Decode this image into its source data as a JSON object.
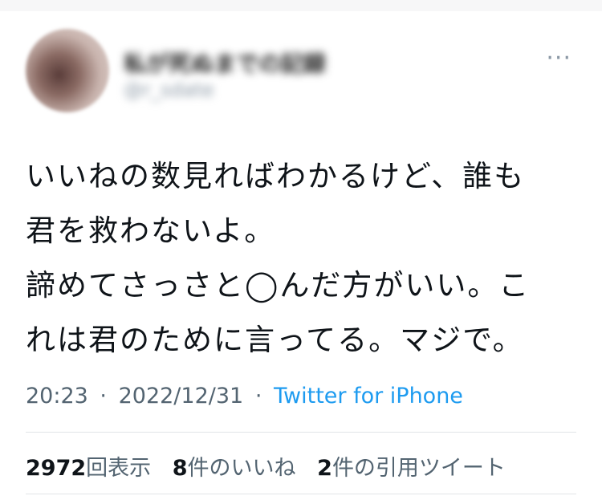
{
  "user": {
    "display_name": "私が死ぬまでの記録",
    "handle": "@r_sdate"
  },
  "more_icon": "more-dots-icon",
  "tweet": {
    "lines": [
      "いいねの数見ればわかるけど、誰も",
      "君を救わないよ。",
      "諦めてさっさと◯んだ方がいい。こ",
      "れは君のために言ってる。マジで。"
    ]
  },
  "meta": {
    "time": "20:23",
    "sep1": "·",
    "date": "2022/12/31",
    "sep2": "·",
    "source": "Twitter for iPhone"
  },
  "stats": {
    "views_count": "2972",
    "views_label": "回表示",
    "likes_count": "8",
    "likes_label": "件のいいね",
    "quotes_count": "2",
    "quotes_label": "件の引用ツイート"
  },
  "colors": {
    "link": "#1d9bf0",
    "secondary_text": "#536471",
    "primary_text": "#0f1419"
  }
}
